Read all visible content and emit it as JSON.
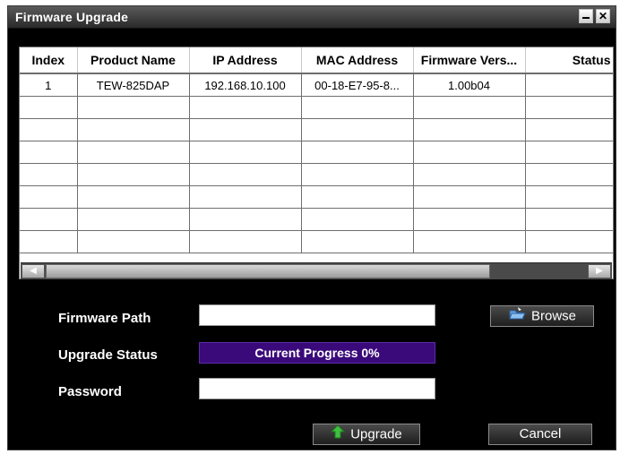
{
  "window": {
    "title": "Firmware Upgrade"
  },
  "table": {
    "columns": [
      "Index",
      "Product Name",
      "IP Address",
      "MAC Address",
      "Firmware Vers...",
      "Status"
    ],
    "rows": [
      [
        "1",
        "TEW-825DAP",
        "192.168.10.100",
        "00-18-E7-95-8...",
        "1.00b04",
        ""
      ],
      [
        "",
        "",
        "",
        "",
        "",
        ""
      ],
      [
        "",
        "",
        "",
        "",
        "",
        ""
      ],
      [
        "",
        "",
        "",
        "",
        "",
        ""
      ],
      [
        "",
        "",
        "",
        "",
        "",
        ""
      ],
      [
        "",
        "",
        "",
        "",
        "",
        ""
      ],
      [
        "",
        "",
        "",
        "",
        "",
        ""
      ],
      [
        "",
        "",
        "",
        "",
        "",
        ""
      ]
    ]
  },
  "form": {
    "firmware_path_label": "Firmware Path",
    "firmware_path_value": "",
    "upgrade_status_label": "Upgrade Status",
    "progress_text": "Current Progress 0%",
    "progress_value": 0,
    "password_label": "Password",
    "password_value": ""
  },
  "buttons": {
    "browse": "Browse",
    "upgrade": "Upgrade",
    "cancel": "Cancel"
  },
  "colors": {
    "window_bg": "#000000",
    "progress_bg": "#3a0a7a",
    "upgrade_icon": "#3fbf3f",
    "browse_icon": "#4a8fd8"
  },
  "icons": {
    "browse": "folder-open-icon",
    "upgrade": "up-arrow-icon"
  }
}
